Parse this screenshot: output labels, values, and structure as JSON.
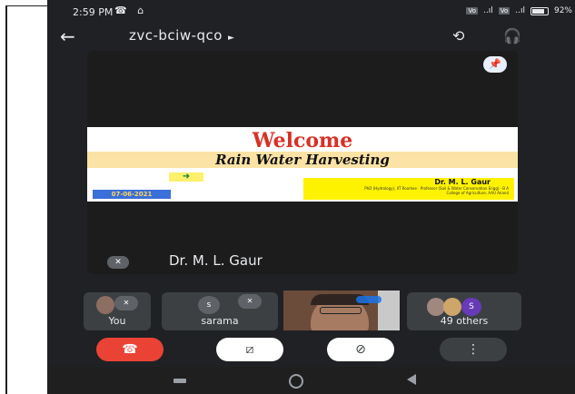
{
  "status_bar": {
    "time": "2:59 PM",
    "left_icons": "☎ ⌂",
    "volte1": "Vo",
    "volte2": "Vo",
    "signal": "..ıl",
    "battery": "92%"
  },
  "app_bar": {
    "back_icon": "arrow-back-icon",
    "meeting_code": "zvc-bciw-qco",
    "caret": "►",
    "camera_flip_icon": "camera-flip-icon",
    "audio_output_icon": "headphones-icon"
  },
  "main_stage": {
    "pin_icon": "pin-icon",
    "slide": {
      "title": "Welcome",
      "subtitle": "Rain Water Harvesting",
      "arrow": "➜",
      "date": "07-06-2021",
      "author_name": "Dr. M. L. Gaur",
      "author_details": "PhD (Hydrology), IIT Roorkee · Professor (Soil & Water Conservation Engg) · B A College of Agriculture, AAU Anand"
    },
    "speaker_name": "Dr. M. L. Gaur"
  },
  "participants": [
    {
      "label": "You"
    },
    {
      "label": "sarama",
      "avatar_letter": "s"
    },
    {
      "label": "49 others",
      "avatar_letter": "S"
    }
  ],
  "controls": {
    "end_call_icon": "end-call-icon",
    "camera_icon": "camera-off-icon",
    "mic_icon": "mic-off-icon",
    "more_icon": "more-icon"
  },
  "colors": {
    "background": "#202124",
    "end_call": "#ea4335",
    "toggle_off": "#ffffff",
    "more": "#3c4043",
    "welcome_red": "#d93025",
    "avatar_purple": "#673ab7"
  }
}
